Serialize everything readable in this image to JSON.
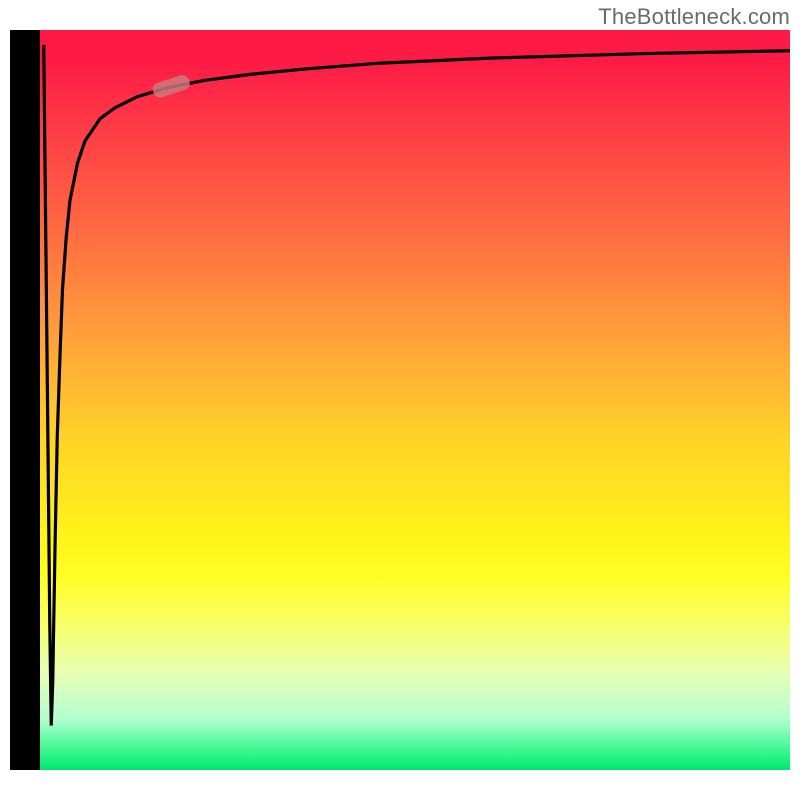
{
  "attribution": "TheBottleneck.com",
  "chart_data": {
    "type": "line",
    "title": "",
    "xlabel": "",
    "ylabel": "",
    "xlim": [
      0,
      100
    ],
    "ylim": [
      0,
      100
    ],
    "gradient_note": "Background vertical gradient from red (top) through orange/yellow to green (bottom)",
    "series": [
      {
        "name": "curve",
        "x": [
          0.5,
          1.0,
          1.3,
          1.5,
          1.7,
          2.0,
          2.3,
          2.7,
          3.0,
          3.5,
          4.0,
          5.0,
          6.0,
          8.0,
          10.0,
          13.0,
          17.0,
          22.0,
          28.0,
          35.0,
          45.0,
          60.0,
          80.0,
          100.0
        ],
        "values": [
          98,
          50,
          20,
          6,
          12,
          30,
          45,
          57,
          65,
          72,
          77,
          82,
          85,
          88,
          89.5,
          91,
          92.2,
          93.2,
          94.0,
          94.7,
          95.5,
          96.2,
          96.8,
          97.2
        ],
        "comment": "Sharp vertical dip near x≈1 then asymptotic rise toward ~97"
      }
    ],
    "marker": {
      "x": 17.5,
      "y": 92.4
    }
  },
  "colors": {
    "axis": "#000000",
    "curve": "#000000",
    "marker": "#cc7b80",
    "attribution_text": "#6a6a6a"
  }
}
